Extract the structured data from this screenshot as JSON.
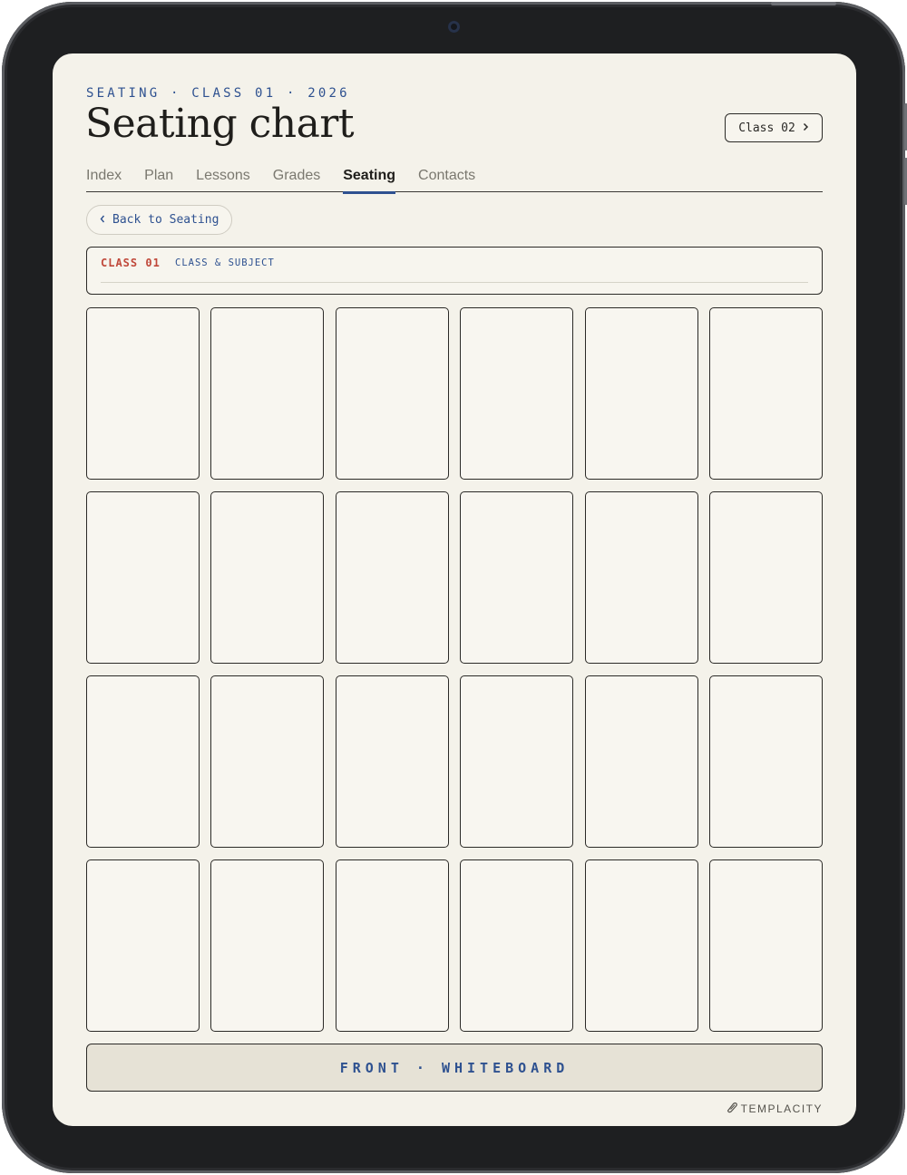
{
  "header": {
    "eyebrow": "SEATING · CLASS 01 · 2026",
    "title": "Seating chart",
    "next_class_label": "Class 02",
    "next_class_icon": "chevron-right-icon"
  },
  "nav": {
    "tabs": [
      {
        "label": "Index"
      },
      {
        "label": "Plan"
      },
      {
        "label": "Lessons"
      },
      {
        "label": "Grades"
      },
      {
        "label": "Seating",
        "active": true
      },
      {
        "label": "Contacts"
      }
    ]
  },
  "back": {
    "label": "Back to Seating",
    "icon": "chevron-left-icon"
  },
  "class_field": {
    "code": "CLASS 01",
    "label": "CLASS & SUBJECT",
    "value": ""
  },
  "seats": {
    "rows": 4,
    "cols": 6,
    "names": [
      "",
      "",
      "",
      "",
      "",
      "",
      "",
      "",
      "",
      "",
      "",
      "",
      "",
      "",
      "",
      "",
      "",
      "",
      "",
      "",
      "",
      "",
      "",
      ""
    ]
  },
  "front": {
    "label": "FRONT · WHITEBOARD"
  },
  "brand": {
    "name": "TEMPLACITY",
    "icon": "templacity-logo-icon"
  },
  "colors": {
    "accent_blue": "#2e5190",
    "accent_red": "#c0483a",
    "paper": "#f4f2ea",
    "ink": "#1f1e1b",
    "bezel": "#1e1f21"
  }
}
